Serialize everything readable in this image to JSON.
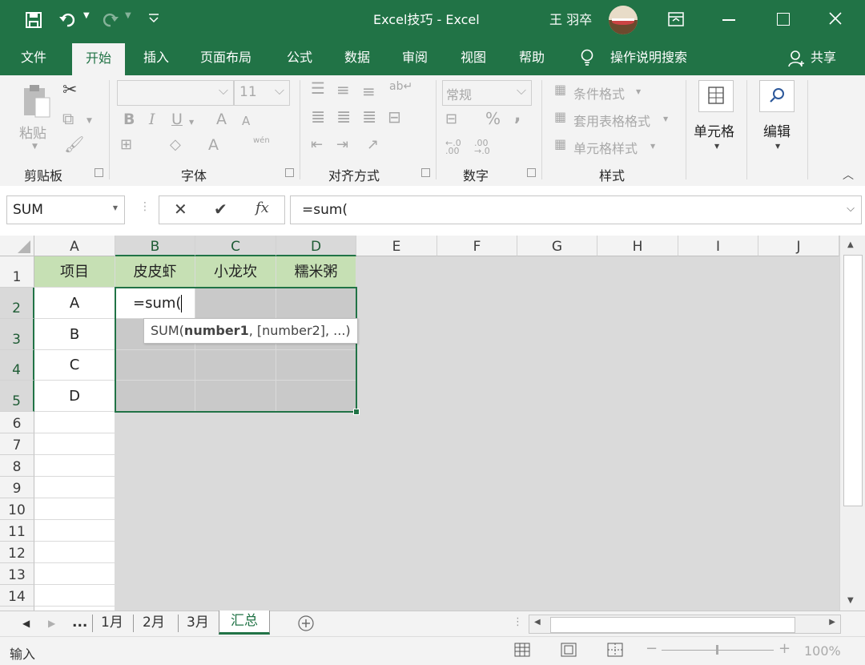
{
  "title_bar": {
    "doc_title": "Excel技巧  -  Excel",
    "user_name": "王 羽卒",
    "quick_access": [
      "save-icon",
      "undo-icon",
      "redo-icon",
      "customize-icon"
    ]
  },
  "tabs": [
    "文件",
    "开始",
    "插入",
    "页面布局",
    "公式",
    "数据",
    "审阅",
    "视图",
    "帮助"
  ],
  "active_tab": "开始",
  "tell_me": "操作说明搜索",
  "share": "共享",
  "ribbon": {
    "clipboard": {
      "paste": "粘贴",
      "group": "剪贴板"
    },
    "font": {
      "size": "11",
      "group": "字体",
      "bold": "B",
      "italic": "I",
      "underline": "U",
      "grow": "A",
      "shrink": "A",
      "font_color": "A",
      "phonetic": "wén"
    },
    "alignment": {
      "group": "对齐方式"
    },
    "number": {
      "format": "常规",
      "percent": "%",
      "comma": ",",
      "inc": "←.0 .00",
      "dec": ".00 →.0",
      "group": "数字"
    },
    "styles": {
      "conditional": "条件格式",
      "table": "套用表格格式",
      "cell": "单元格样式",
      "group": "样式"
    },
    "cells": {
      "label": "单元格"
    },
    "editing": {
      "label": "编辑"
    }
  },
  "formula_bar": {
    "name_box": "SUM",
    "formula": "=sum(",
    "fx": "fx"
  },
  "columns": [
    "A",
    "B",
    "C",
    "D",
    "E",
    "F",
    "G",
    "H",
    "I",
    "J"
  ],
  "rows": [
    "1",
    "2",
    "3",
    "4",
    "5",
    "6",
    "7",
    "8",
    "9",
    "10",
    "11",
    "12",
    "13",
    "14"
  ],
  "table": {
    "headers": [
      "项目",
      "皮皮虾",
      "小龙坎",
      "糯米粥"
    ],
    "items": [
      "A",
      "B",
      "C",
      "D"
    ],
    "editing_cell": "=sum("
  },
  "tooltip": {
    "fn": "SUM(",
    "arg1": "number1",
    "rest": ", [number2], ...)"
  },
  "sheets": [
    "...",
    "1月",
    "2月",
    "3月",
    "汇总"
  ],
  "active_sheet": "汇总",
  "status": {
    "mode": "输入",
    "zoom": "100%"
  },
  "colors": {
    "accent": "#217346",
    "header_fill": "#c6e0b4",
    "selection_fill": "#c9c9c9"
  }
}
